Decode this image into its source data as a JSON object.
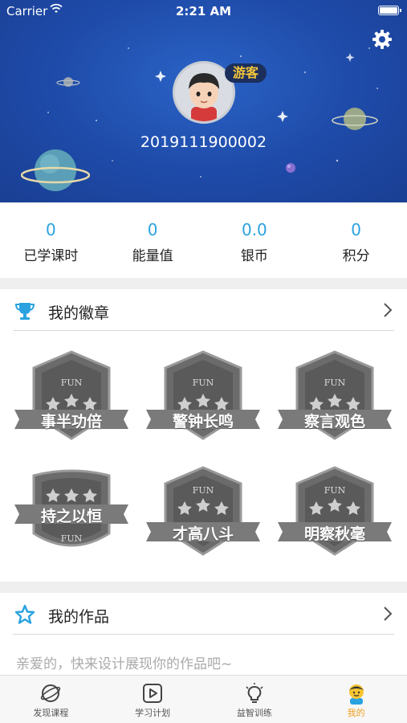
{
  "status_bar": {
    "carrier": "Carrier",
    "time": "2:21 AM"
  },
  "profile": {
    "guest_badge": "游客",
    "user_id": "2019111900002"
  },
  "stats": [
    {
      "value": "0",
      "label": "已学课时"
    },
    {
      "value": "0",
      "label": "能量值"
    },
    {
      "value": "0.0",
      "label": "银币"
    },
    {
      "value": "0",
      "label": "积分"
    }
  ],
  "badges_section": {
    "title": "我的徽章",
    "badges": [
      {
        "name": "事半功倍",
        "icon": "badge-shield-icon",
        "emblem": "FUN"
      },
      {
        "name": "警钟长鸣",
        "icon": "badge-shield-icon",
        "emblem": "FUN"
      },
      {
        "name": "察言观色",
        "icon": "badge-shield-icon",
        "emblem": "FUN"
      },
      {
        "name": "持之以恒",
        "icon": "badge-shield-icon",
        "emblem": "FUN"
      },
      {
        "name": "才高八斗",
        "icon": "badge-shield-icon",
        "emblem": "FUN"
      },
      {
        "name": "明察秋毫",
        "icon": "badge-shield-icon",
        "emblem": "FUN"
      }
    ]
  },
  "works_section": {
    "title": "我的作品",
    "hint": "亲爱的，快来设计展现你的作品吧~"
  },
  "tabbar": [
    {
      "label": "发现课程",
      "icon": "compass-planet-icon",
      "active": false
    },
    {
      "label": "学习计划",
      "icon": "play-square-icon",
      "active": false
    },
    {
      "label": "益智训练",
      "icon": "bulb-icon",
      "active": false
    },
    {
      "label": "我的",
      "icon": "smiley-person-icon",
      "active": true
    }
  ],
  "colors": {
    "hero_blue": "#1e4aa8",
    "accent_blue": "#2aa2e0",
    "active_orange": "#f0a020",
    "guest_gold": "#f3c43a"
  }
}
